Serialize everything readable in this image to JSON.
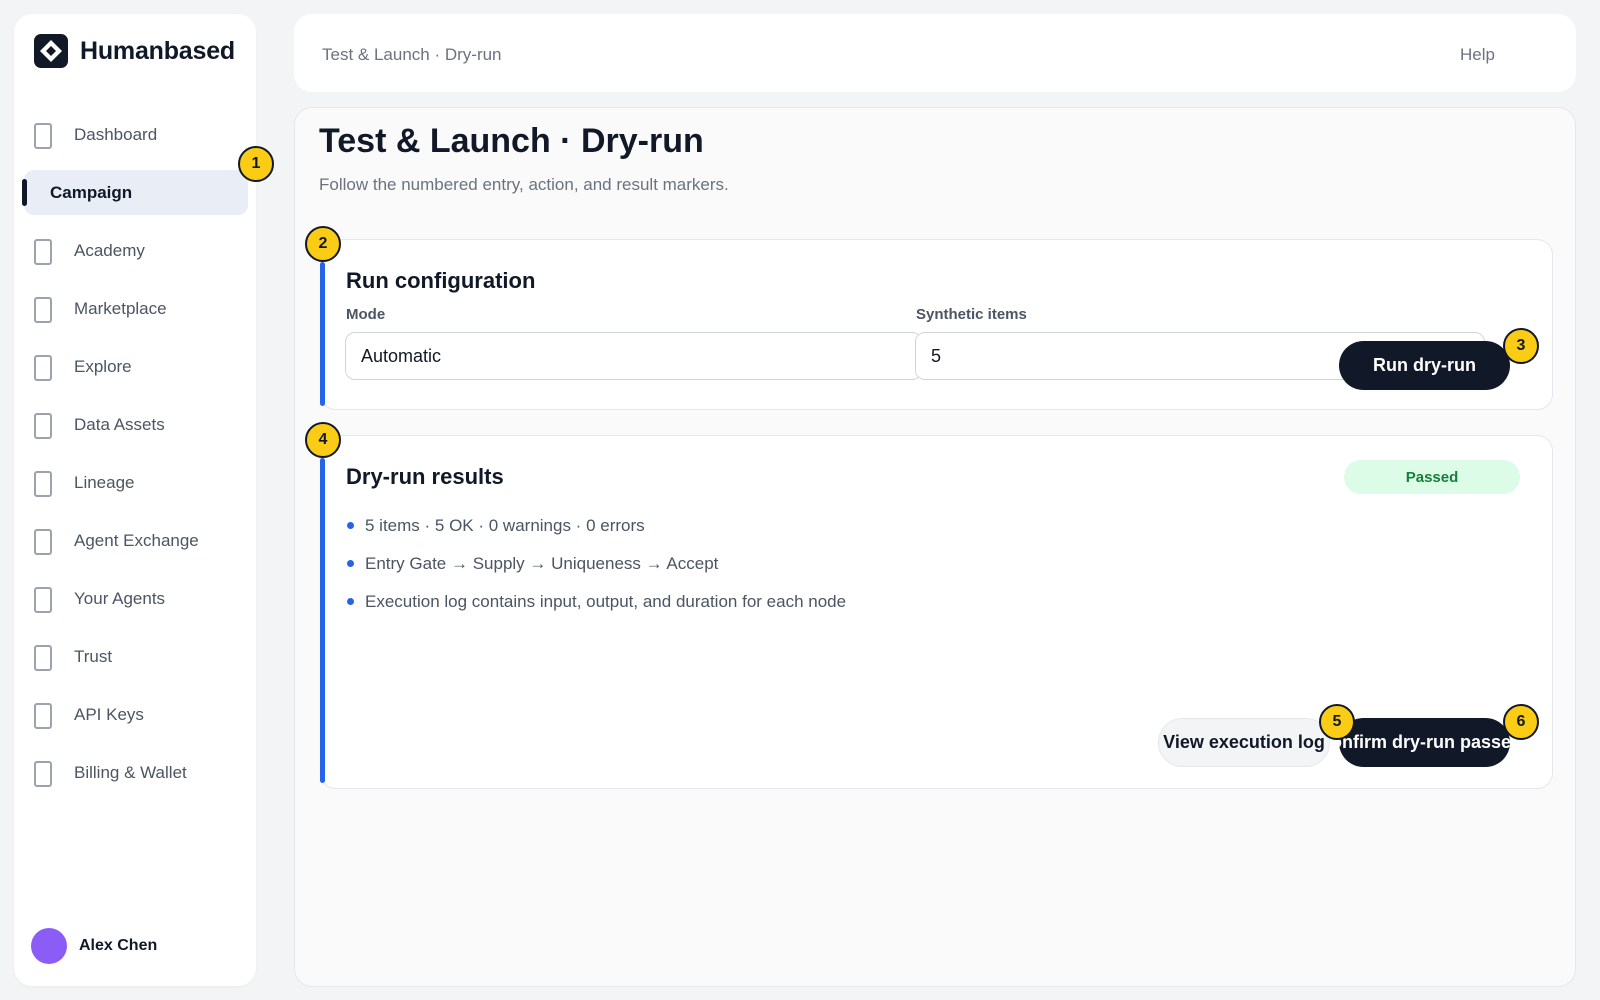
{
  "brand": {
    "name": "Humanbased"
  },
  "sidebar": {
    "items": [
      {
        "label": "Dashboard",
        "active": false
      },
      {
        "label": "Campaign",
        "active": true
      },
      {
        "label": "Academy",
        "active": false
      },
      {
        "label": "Marketplace",
        "active": false
      },
      {
        "label": "Explore",
        "active": false
      },
      {
        "label": "Data Assets",
        "active": false
      },
      {
        "label": "Lineage",
        "active": false
      },
      {
        "label": "Agent Exchange",
        "active": false
      },
      {
        "label": "Your Agents",
        "active": false
      },
      {
        "label": "Trust",
        "active": false
      },
      {
        "label": "API Keys",
        "active": false
      },
      {
        "label": "Billing & Wallet",
        "active": false
      }
    ]
  },
  "user": {
    "name": "Alex Chen",
    "avatar_color": "#8b5cf6"
  },
  "header": {
    "breadcrumb": "Test & Launch · Dry-run",
    "help_label": "Help"
  },
  "page": {
    "title": "Test & Launch · Dry-run",
    "subtitle": "Follow the numbered entry, action, and result markers."
  },
  "config": {
    "title": "Run configuration",
    "mode_label": "Mode",
    "mode_value": "Automatic",
    "items_label": "Synthetic items",
    "items_value": "5",
    "run_button": "Run dry-run"
  },
  "results": {
    "title": "Dry-run results",
    "status": "Passed",
    "items": [
      "5 items · 5 OK · 0 warnings · 0 errors",
      "Entry Gate → Supply → Uniqueness → Accept",
      "Execution log contains input, output, and duration for each node"
    ],
    "view_log_button": "View execution log",
    "confirm_button": "Confirm dry-run passed"
  },
  "markers": [
    "1",
    "2",
    "3",
    "4",
    "5",
    "6"
  ],
  "colors": {
    "accent": "#2563eb",
    "marker": "#facc15",
    "primary_button": "#111827",
    "success": "#15803d",
    "success_bg": "#dcfce7"
  }
}
